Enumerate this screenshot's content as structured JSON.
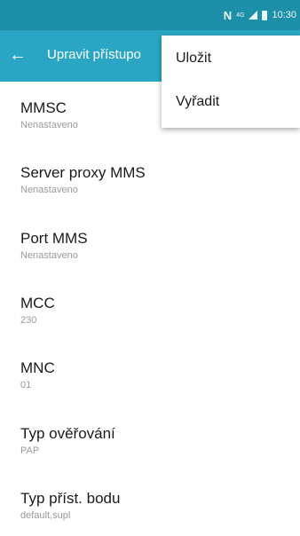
{
  "status_bar": {
    "nfc": "N",
    "lte": "4G",
    "time": "10:30"
  },
  "app_bar": {
    "back_icon": "arrow-left-icon",
    "title": "Upravit přístupo"
  },
  "settings": [
    {
      "label": "MMSC",
      "value": "Nenastaveno"
    },
    {
      "label": "Server proxy MMS",
      "value": "Nenastaveno"
    },
    {
      "label": "Port MMS",
      "value": "Nenastaveno"
    },
    {
      "label": "MCC",
      "value": "230"
    },
    {
      "label": "MNC",
      "value": "01"
    },
    {
      "label": "Typ ověřování",
      "value": "PAP"
    },
    {
      "label": "Typ příst. bodu",
      "value": "default,supl"
    }
  ],
  "menu": {
    "items": [
      "Uložit",
      "Vyřadit"
    ]
  },
  "colors": {
    "status_bar": "#1e8fa8",
    "app_bar": "#2aa6c4",
    "secondary_text": "#9a9a9a"
  }
}
